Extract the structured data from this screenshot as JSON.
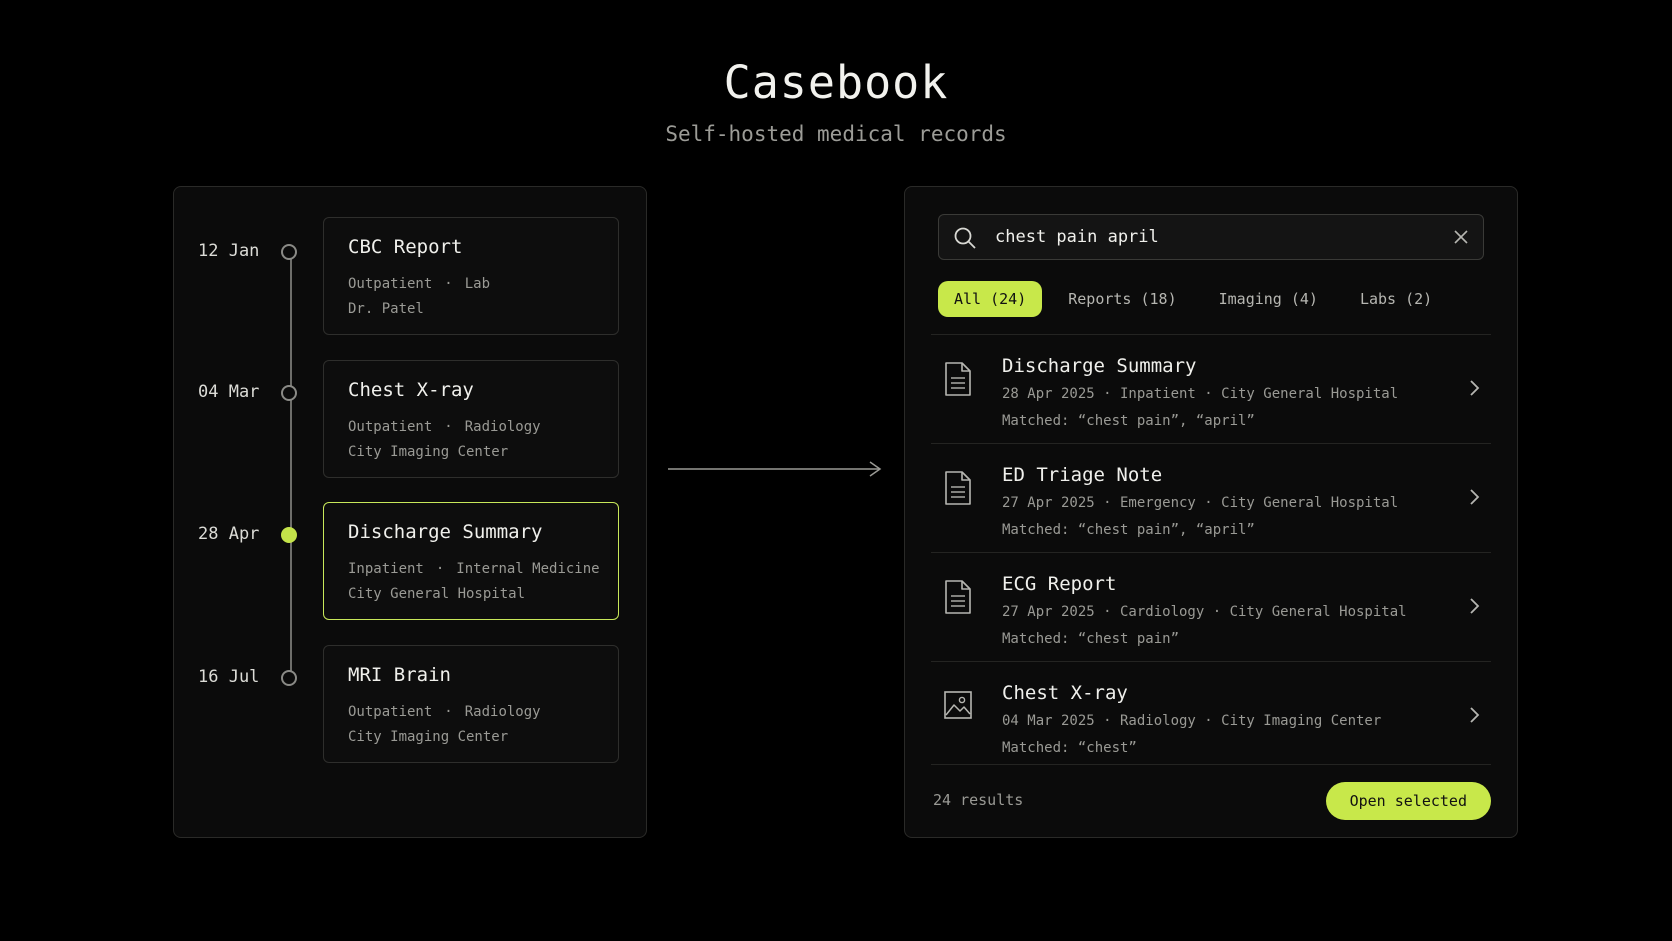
{
  "app": {
    "title": "Casebook",
    "subtitle": "Self-hosted medical records"
  },
  "colors": {
    "accent": "#c8e84a",
    "background": "#000000",
    "panel": "#0b0b0b"
  },
  "timeline": {
    "items": [
      {
        "date": "12 Jan",
        "title": "CBC Report",
        "meta1a": "Outpatient",
        "meta1b": "Lab",
        "meta2": "Dr. Patel",
        "active": false
      },
      {
        "date": "04 Mar",
        "title": "Chest X-ray",
        "meta1a": "Outpatient",
        "meta1b": "Radiology",
        "meta2": "City Imaging Center",
        "active": false
      },
      {
        "date": "28 Apr",
        "title": "Discharge Summary",
        "meta1a": "Inpatient",
        "meta1b": "Internal Medicine",
        "meta2": "City General Hospital",
        "active": true
      },
      {
        "date": "16 Jul",
        "title": "MRI Brain",
        "meta1a": "Outpatient",
        "meta1b": "Radiology",
        "meta2": "City Imaging Center",
        "active": false
      }
    ]
  },
  "search": {
    "query": "chest pain april",
    "tabs": [
      {
        "label": "All (24)",
        "active": true
      },
      {
        "label": "Reports (18)",
        "active": false
      },
      {
        "label": "Imaging (4)",
        "active": false
      },
      {
        "label": "Labs (2)",
        "active": false
      }
    ],
    "results": [
      {
        "icon": "document-icon",
        "title": "Discharge Summary",
        "meta": "28 Apr 2025 · Inpatient · City General Hospital",
        "matched": "Matched: “chest pain”, “april”"
      },
      {
        "icon": "document-icon",
        "title": "ED Triage Note",
        "meta": "27 Apr 2025 · Emergency · City General Hospital",
        "matched": "Matched: “chest pain”, “april”"
      },
      {
        "icon": "document-icon",
        "title": "ECG Report",
        "meta": "27 Apr 2025 · Cardiology · City General Hospital",
        "matched": "Matched: “chest pain”"
      },
      {
        "icon": "image-icon",
        "title": "Chest X-ray",
        "meta": "04 Mar 2025 · Radiology · City Imaging Center",
        "matched": "Matched: “chest”"
      }
    ],
    "result_count": "24 results",
    "open_label": "Open selected"
  }
}
